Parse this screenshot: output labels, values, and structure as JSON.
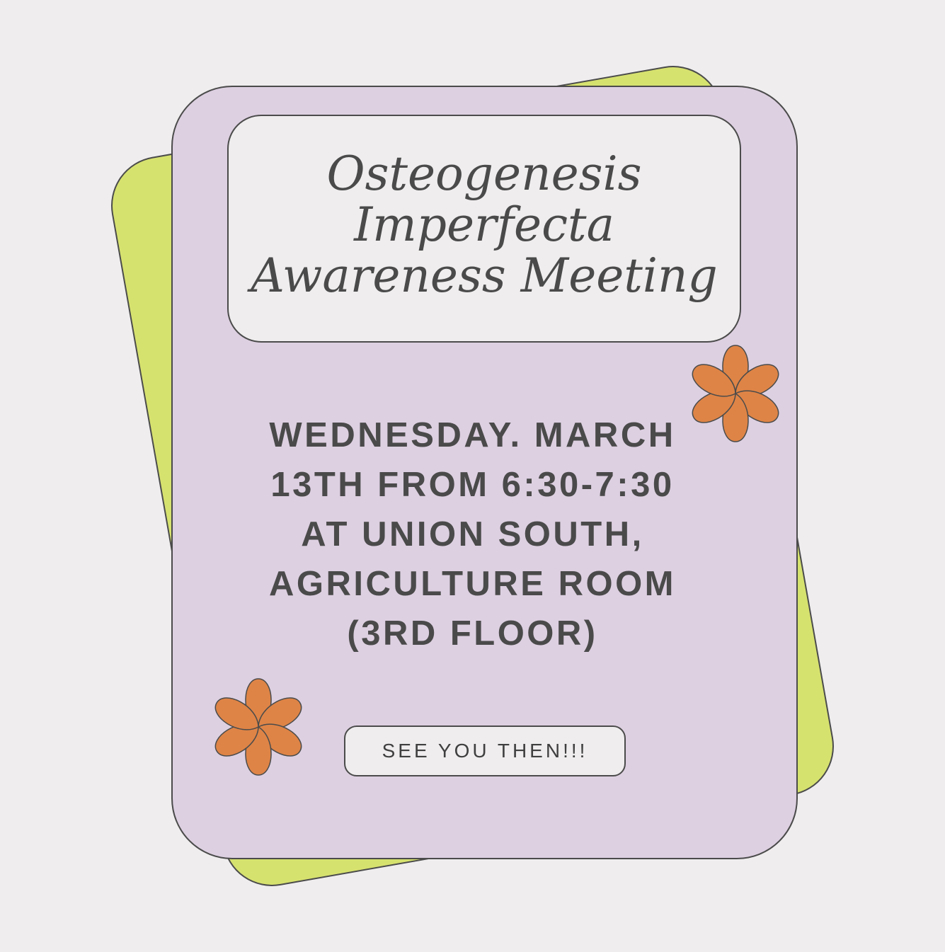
{
  "colors": {
    "background": "#efeded",
    "back_card": "#d6e26e",
    "main_card": "#ddd0e1",
    "title_box": "#efeded",
    "flower": "#de8446",
    "text": "#4a4a4a",
    "outline": "#4b4b4b"
  },
  "icons": {
    "decoration": "flower-icon"
  },
  "flyer": {
    "title_lines": [
      "Osteogenesis",
      "Imperfecta",
      "Awareness Meeting"
    ],
    "detail_lines": [
      "WEDNESDAY. MARCH",
      "13TH FROM 6:30-7:30",
      "AT UNION SOUTH,",
      "AGRICULTURE ROOM",
      "(3RD FLOOR)"
    ],
    "cta_label": "SEE YOU THEN!!!"
  }
}
